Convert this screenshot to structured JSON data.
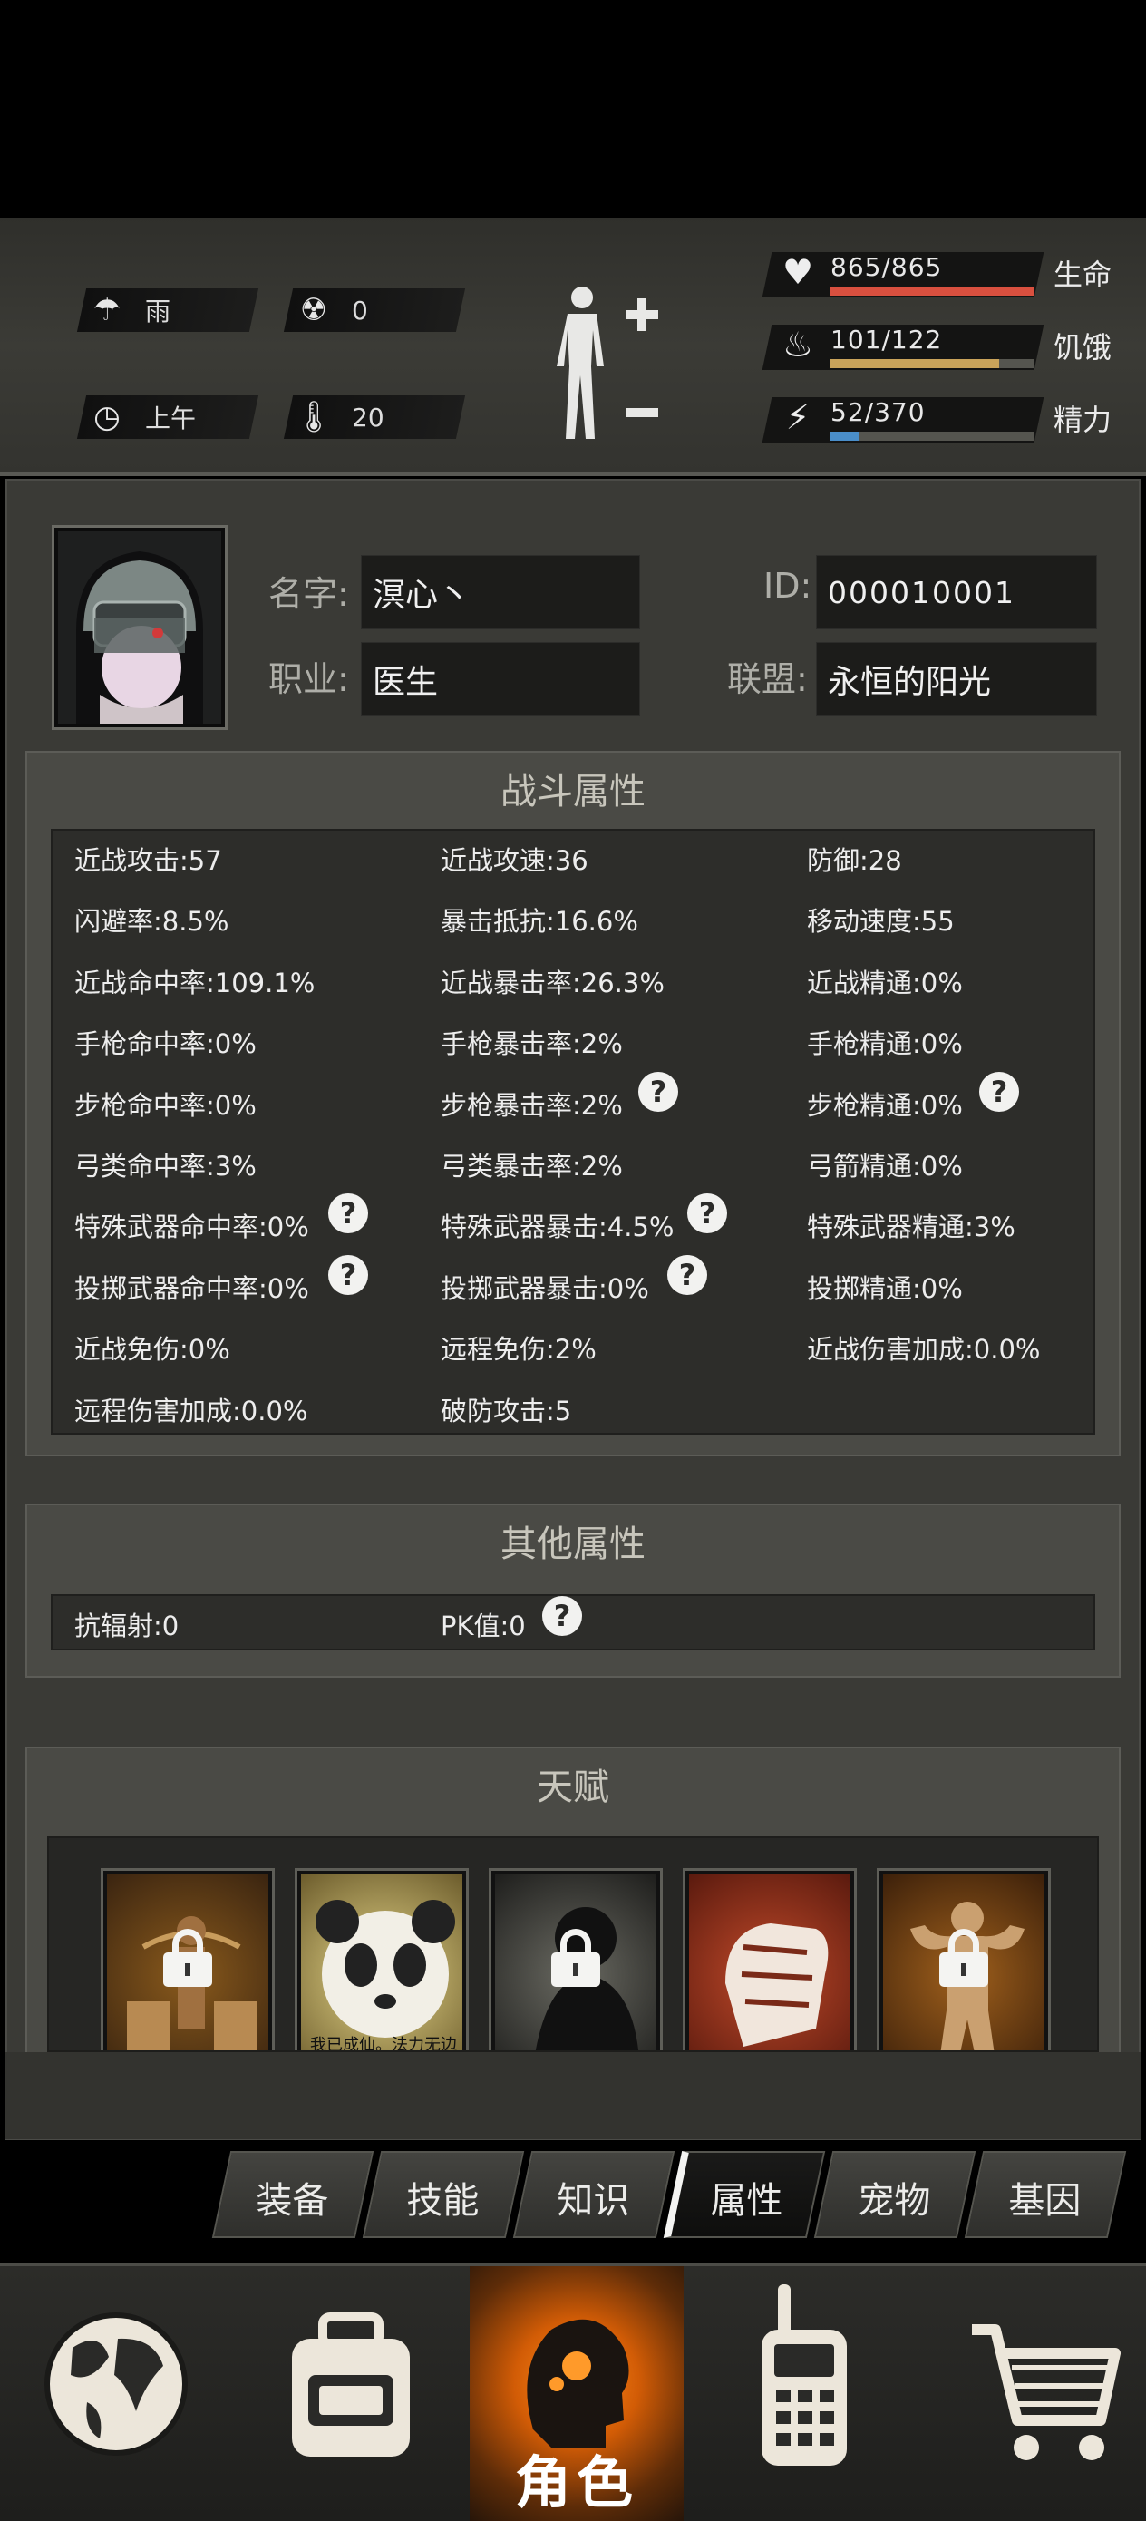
{
  "status": {
    "weather": "雨",
    "radiation": "0",
    "time_of_day": "上午",
    "temperature": "20",
    "vitals": [
      {
        "icon": "heart-icon",
        "value": "865/865",
        "label": "生命",
        "fill": 1.0,
        "color": "#d9503f"
      },
      {
        "icon": "stomach-icon",
        "value": "101/122",
        "label": "饥饿",
        "fill": 0.83,
        "color": "#c9a35a"
      },
      {
        "icon": "energy-icon",
        "value": "52/370",
        "label": "精力",
        "fill": 0.14,
        "color": "#4a8ec9"
      }
    ]
  },
  "profile": {
    "name_label": "名字:",
    "name": "溟心丶",
    "id_label": "ID:",
    "id": "000010001",
    "job_label": "职业:",
    "job": "医生",
    "alliance_label": "联盟:",
    "alliance": "永恒的阳光"
  },
  "combat": {
    "title": "战斗属性",
    "rows": [
      [
        "近战攻击:57",
        "近战攻速:36",
        "防御:28"
      ],
      [
        "闪避率:8.5%",
        "暴击抵抗:16.6%",
        "移动速度:55"
      ],
      [
        "近战命中率:109.1%",
        "近战暴击率:26.3%",
        "近战精通:0%"
      ],
      [
        "手枪命中率:0%",
        "手枪暴击率:2%",
        "手枪精通:0%"
      ],
      [
        "步枪命中率:0%",
        "步枪暴击率:2%",
        "步枪精通:0%"
      ],
      [
        "弓类命中率:3%",
        "弓类暴击率:2%",
        "弓箭精通:0%"
      ],
      [
        "特殊武器命中率:0%",
        "特殊武器暴击:4.5%",
        "特殊武器精通:3%"
      ],
      [
        "投掷武器命中率:0%",
        "投掷武器暴击:0%",
        "投掷精通:0%"
      ],
      [
        "近战免伤:0%",
        "远程免伤:2%",
        "近战伤害加成:0.0%"
      ],
      [
        "远程伤害加成:0.0%",
        "破防攻击:5",
        ""
      ]
    ]
  },
  "other": {
    "title": "其他属性",
    "radiation_resist": "抗辐射:0",
    "pk": "PK值:0"
  },
  "talent": {
    "title": "天赋",
    "card2_caption": "我已成仙。法力无边"
  },
  "tabs": [
    "装备",
    "技能",
    "知识",
    "属性",
    "宠物",
    "基因"
  ],
  "active_tab": "属性",
  "nav": {
    "active_label": "角色"
  }
}
